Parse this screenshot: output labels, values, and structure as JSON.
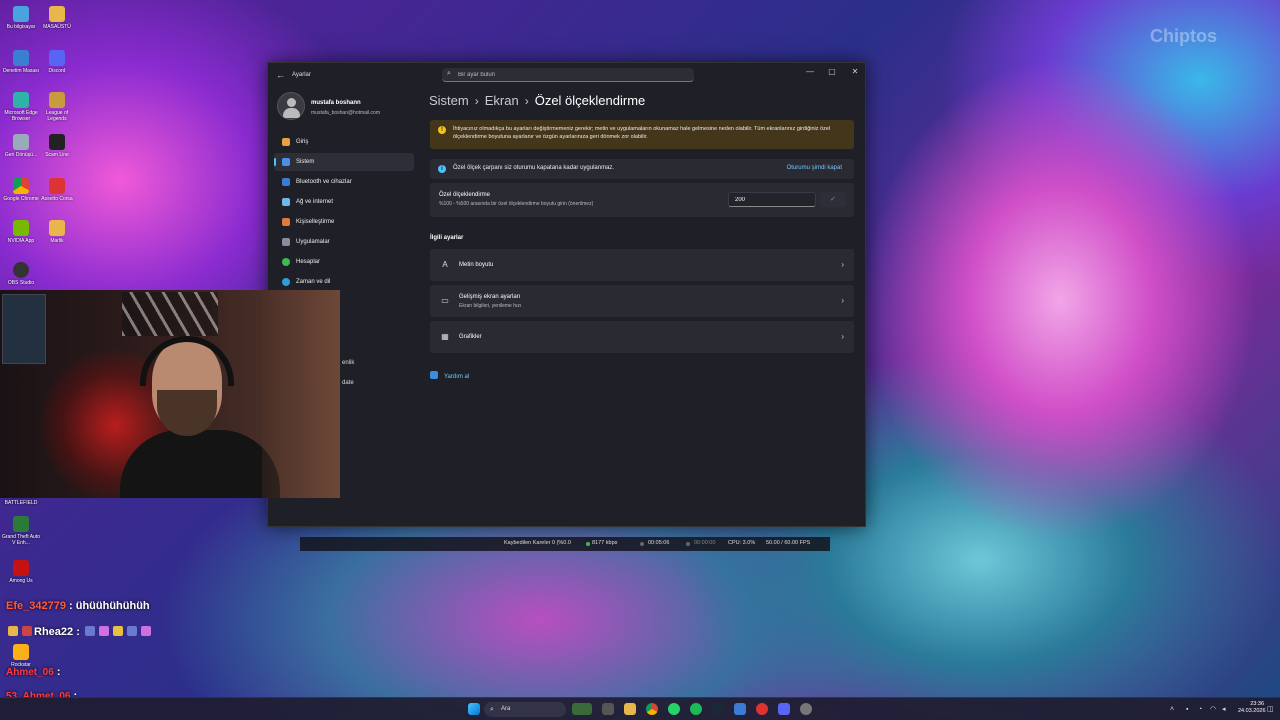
{
  "desktop": {
    "watermark": "Chiptos",
    "icons": [
      {
        "label": "Bu bilgisayar"
      },
      {
        "label": "MASAÜSTÜ"
      },
      {
        "label": "Denetim Masası"
      },
      {
        "label": "Discord"
      },
      {
        "label": "Microsoft Edge Browser"
      },
      {
        "label": "League of Legends"
      },
      {
        "label": "Geri Dönüşü..."
      },
      {
        "label": "Scam Line"
      },
      {
        "label": "Google Chrome"
      },
      {
        "label": "Assetto Corsa"
      },
      {
        "label": "NVIDIA App"
      },
      {
        "label": "Marlik"
      },
      {
        "label": "OBS Studio"
      },
      {
        "label": "BATTLEFIELD"
      },
      {
        "label": "Grand Theft Auto V Enh..."
      },
      {
        "label": "Among Us"
      },
      {
        "label": "Rockstar"
      }
    ]
  },
  "window": {
    "app_title": "Ayarlar",
    "search_placeholder": "Bir ayar bulun",
    "controls": {
      "minimize": "—",
      "maximize": "▢",
      "close": "✕"
    },
    "user": {
      "name": "mustafa boshann",
      "email": "mustafa_boshan@hotmail.com"
    },
    "nav": [
      {
        "label": "Giriş",
        "color": "#e8a040",
        "active": false
      },
      {
        "label": "Sistem",
        "color": "#4a90e2",
        "active": true
      },
      {
        "label": "Bluetooth ve cihazlar",
        "color": "#3a7bd5",
        "active": false
      },
      {
        "label": "Ağ ve internet",
        "color": "#6fb7e8",
        "active": false
      },
      {
        "label": "Kişiselleştirme",
        "color": "#e07b39",
        "active": false
      },
      {
        "label": "Uygulamalar",
        "color": "#8a8a9a",
        "active": false
      },
      {
        "label": "Hesaplar",
        "color": "#3fb950",
        "active": false
      },
      {
        "label": "Zaman ve dil",
        "color": "#2f9ed8",
        "active": false
      }
    ],
    "nav_partial": [
      "enlik",
      "date"
    ],
    "breadcrumb": {
      "level1": "Sistem",
      "level2": "Ekran",
      "current": "Özel ölçeklendirme",
      "separator": "›"
    },
    "warning": {
      "icon": "!",
      "text": "İhtiyacınız olmadıkça bu ayarları değiştirmemeniz gerekir; metin ve uygulamaların okunamaz hale gelmesine neden olabilir. Tüm ekranlarınız girdiğiniz özel ölçeklendirme boyutuna ayarlanır ve özgün ayarlarınıza geri dönmek zor olabilir."
    },
    "info": {
      "icon": "i",
      "text": "Özel ölçek çarpanı siz oturumu kapatana kadar uygulanmaz.",
      "link": "Oturumu şimdi kapat"
    },
    "custom_scale": {
      "title": "Özel ölçeklendirme",
      "subtitle": "%100 - %500 arasında bir özel ölçeklendirme boyutu girin (önerilmez)",
      "value": "200",
      "apply_icon": "✓"
    },
    "related_label": "İlgili ayarlar",
    "related": [
      {
        "title": "Metin boyutu",
        "subtitle": "",
        "icon": "A",
        "chevron": "›"
      },
      {
        "title": "Gelişmiş ekran ayarları",
        "subtitle": "Ekran bilgileri, yenileme hızı",
        "icon": "▭",
        "chevron": "›"
      },
      {
        "title": "Grafikler",
        "subtitle": "",
        "icon": "▦",
        "chevron": "›"
      }
    ],
    "help": "Yardım al"
  },
  "obs_bar": {
    "dropped": "Kaybedilen Kareler 0 (%0.0",
    "bitrate": "8177 kbps",
    "rec_time": "00:05:06",
    "stream_time": "00:00:00",
    "cpu": "CPU: 3.0%",
    "fps": "50.00 / 60.00 FPS"
  },
  "chat": [
    {
      "user": "Efe_342779",
      "color": "#ff5a3c",
      "message": "ühüühühühüh"
    },
    {
      "user": "Rhea22",
      "color": "#ffffff",
      "message": ""
    },
    {
      "user": "Ahmet_06",
      "color": "#ff3a3a",
      "message": ""
    },
    {
      "user": "53_Ahmet_06",
      "color": "#ff3a3a",
      "message": ""
    }
  ],
  "taskbar": {
    "search_label": "Ara",
    "time": "23:36",
    "date": "24.03.2026"
  }
}
